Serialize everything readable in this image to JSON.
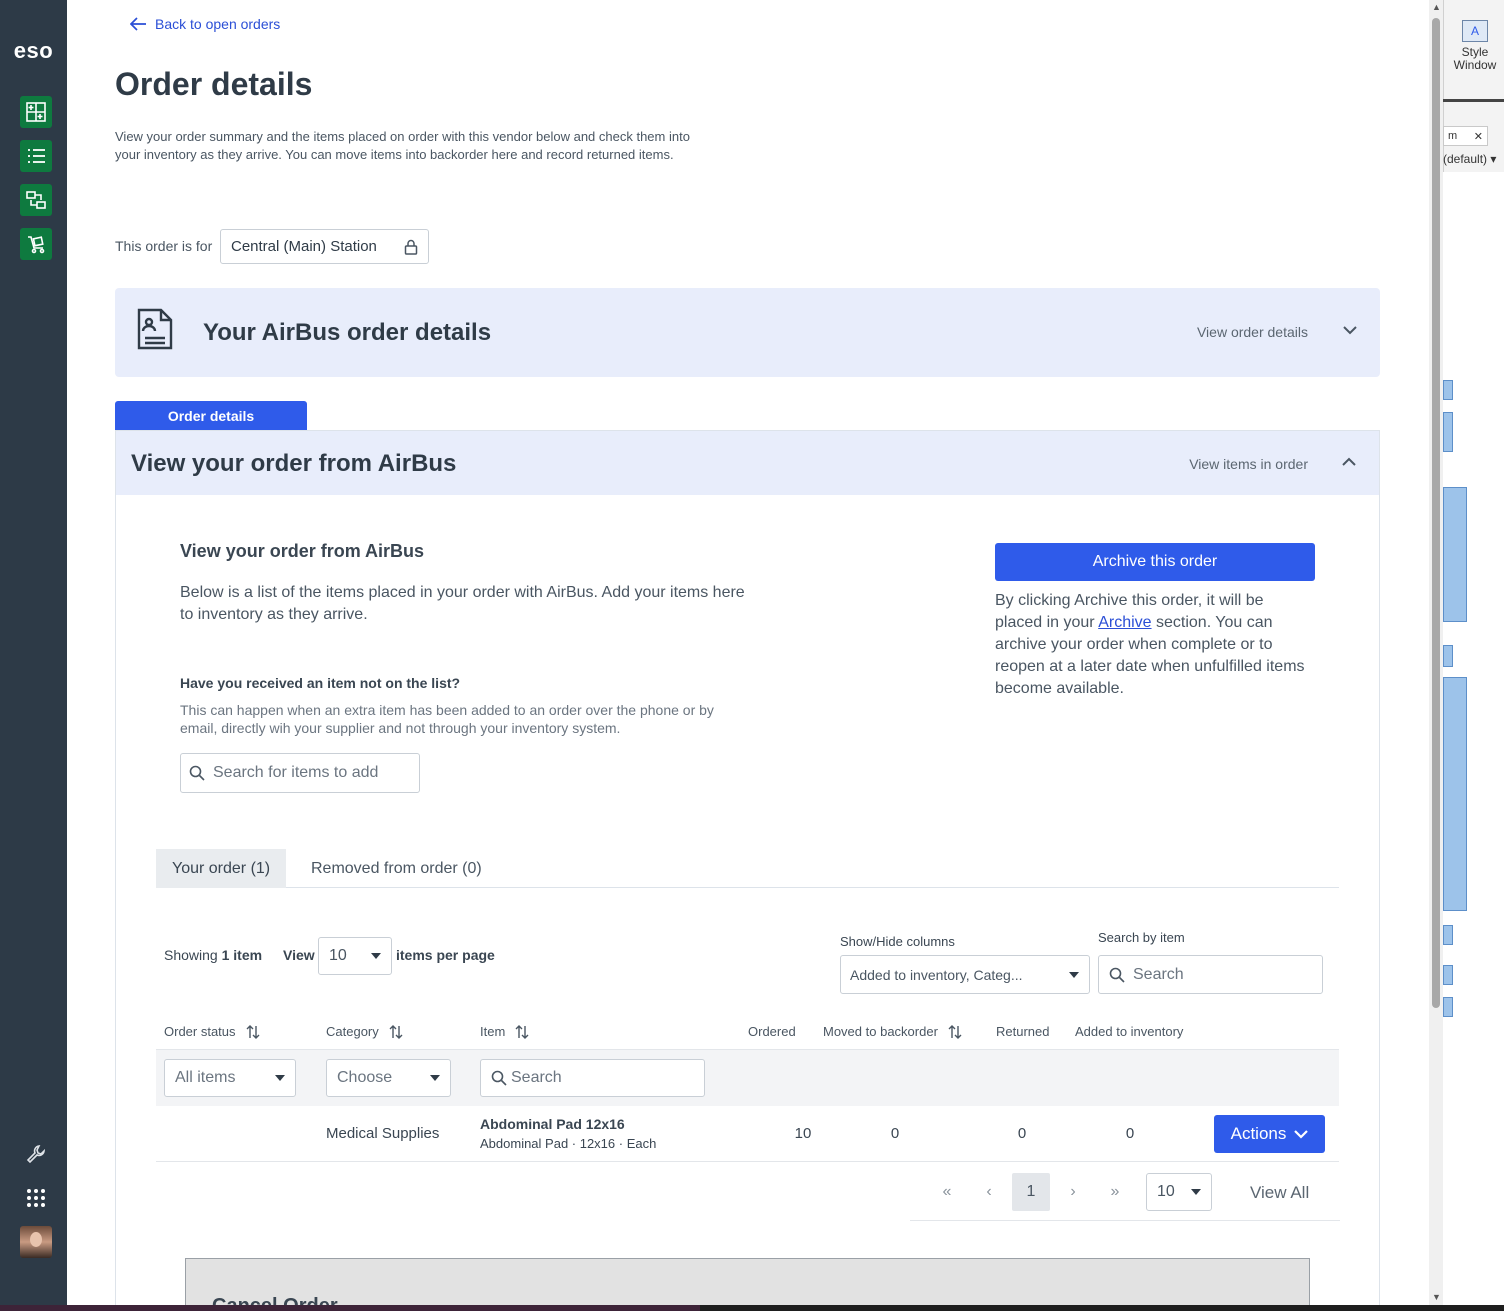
{
  "sidebar": {
    "logo": "eso",
    "nav_icons": [
      "inventory-grid-icon",
      "list-icon",
      "transfer-icon",
      "cart-icon"
    ],
    "bottom_icons": [
      "wrench-icon",
      "apps-grid-icon"
    ]
  },
  "header": {
    "back_link": "Back to open orders",
    "title": "Order details",
    "intro": "View your order summary and the items placed on order with this vendor below and check them into your inventory as they arrive. You can move items into backorder here and record returned items.",
    "order_for_label": "This order is for",
    "order_for_value": "Central (Main) Station"
  },
  "vendor_panel": {
    "title": "Your AirBus order details",
    "toggle_label": "View order details"
  },
  "order_tab": "Order details",
  "order_panel": {
    "title": "View your order from AirBus",
    "toggle_label": "View items in order",
    "sub_title": "View your order from AirBus",
    "sub_desc": "Below is a list of the items placed in your order with AirBus. Add your items here to inventory as they arrive.",
    "received_question": "Have you received an item not on the list?",
    "received_desc": "This can happen when an extra item has been added to an order over the phone or by email, directly wih your supplier and not through your inventory system.",
    "add_search_placeholder": "Search for items to add",
    "archive_button": "Archive this order",
    "archive_desc_before": "By clicking Archive this order, it will be placed in your ",
    "archive_link": "Archive",
    "archive_desc_after": " section. You can archive your order when complete or to reopen at a later date when unfulfilled items become available."
  },
  "tabs": [
    {
      "label": "Your order (1)",
      "active": true
    },
    {
      "label": "Removed from order (0)",
      "active": false
    }
  ],
  "table_controls": {
    "showing_prefix": "Showing ",
    "showing_count": "1 item",
    "view_label": "View",
    "per_page": "10",
    "per_page_label": "items per page",
    "show_hide_label": "Show/Hide columns",
    "show_hide_value": "Added to inventory, Categ...",
    "search_by_label": "Search by item",
    "search_by_placeholder": "Search"
  },
  "columns": [
    "Order status",
    "Category",
    "Item",
    "Ordered",
    "Moved to backorder",
    "Returned",
    "Added to inventory"
  ],
  "filters": {
    "status": "All items",
    "category": "Choose",
    "item_placeholder": "Search"
  },
  "rows": [
    {
      "category": "Medical Supplies",
      "item_name": "Abdominal Pad 12x16",
      "item_desc": "Abdominal Pad · 12x16 · Each",
      "ordered": "10",
      "backorder": "0",
      "returned": "0",
      "added": "0",
      "action": "Actions"
    }
  ],
  "pagination": {
    "current_page": "1",
    "per_page": "10",
    "view_all": "View All"
  },
  "cancel_section": {
    "title": "Cancel Order"
  },
  "right_app": {
    "style_window_line1": "Style",
    "style_window_line2": "Window",
    "tab_label": "m",
    "default_label": "(default)"
  }
}
